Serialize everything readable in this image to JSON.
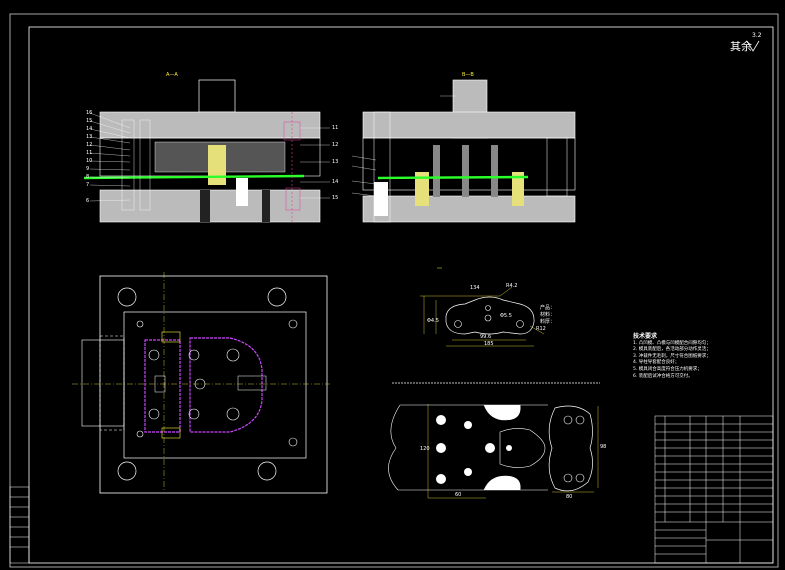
{
  "title_block": {
    "roughness_note": "其余",
    "roughness_value": "3.2",
    "view_labels": [
      "A—A",
      "B—B"
    ],
    "part_name_label": "产品：",
    "part_material_label": "材料：",
    "part_thickness_label": "料厚：",
    "tech_notes_title": "技术要求",
    "tech_notes": [
      "1. 凸凹模、凸模与凹模配合间隙均匀；",
      "2. 模具装配后，各活动部分动作灵活；",
      "3. 冲裁件无毛刺，尺寸符合图纸要求；",
      "4. 导柱导套配合良好；",
      "5. 模具闭合高度符合压力机要求；",
      "6. 装配后试冲合格方可交付。"
    ]
  },
  "dimensions": {
    "part_top": "134",
    "part_r1": "R4.2",
    "part_r2": "R12",
    "part_d1": "Φ5.5",
    "part_d2": "Φ4.5",
    "part_w1": "99.6",
    "part_w2": "185",
    "strip_width": "120",
    "strip_pitch": "60",
    "part_height": "98",
    "part_width": "80"
  },
  "callouts_left": [
    "16",
    "15",
    "14",
    "13",
    "12",
    "11",
    "10",
    "9",
    "8",
    "7",
    "6",
    "5"
  ],
  "callouts_right": [
    "11",
    "12",
    "13",
    "14",
    "15"
  ]
}
